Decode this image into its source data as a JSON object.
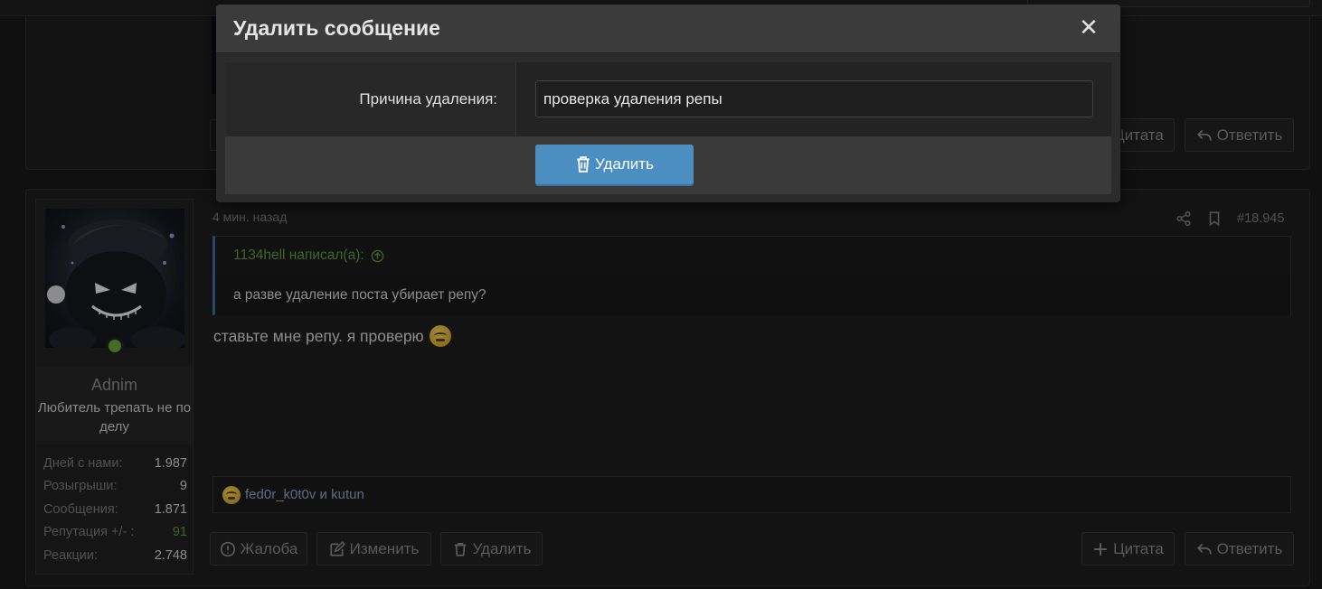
{
  "prev_post": {
    "quote_button": "Цитата",
    "reply_button": "Ответить"
  },
  "user": {
    "name": "Adnim",
    "title": "Любитель трепать не по делу",
    "stats": [
      {
        "label": "Дней с нами:",
        "value": "1.987"
      },
      {
        "label": "Розыгрыши:",
        "value": "9"
      },
      {
        "label": "Сообщения:",
        "value": "1.871"
      },
      {
        "label": "Репутация +/- :",
        "value": "91"
      },
      {
        "label": "Реакции:",
        "value": "2.748"
      }
    ]
  },
  "post": {
    "time": "4 мин. назад",
    "number": "#18.945",
    "quote_author": "1134hell написал(а):",
    "quote_text": "а разве удаление поста убирает репу?",
    "text": "ставьте мне репу. я проверю",
    "reactions_text": "fed0r_k0t0v и kutun",
    "actions": {
      "report": "Жалоба",
      "edit": "Изменить",
      "delete": "Удалить",
      "quote": "Цитата",
      "reply": "Ответить"
    }
  },
  "modal": {
    "title": "Удалить сообщение",
    "close": "✕",
    "reason_label": "Причина удаления:",
    "reason_value": "проверка удаления репы",
    "submit": "Удалить"
  },
  "icons": {
    "close": "close-icon",
    "trash": "trash-icon",
    "share": "share-icon",
    "bookmark": "bookmark-icon",
    "arrow-up": "arrow-up-circle-icon",
    "report": "exclamation-circle-icon",
    "edit": "edit-icon",
    "plus": "plus-icon",
    "reply": "reply-icon"
  },
  "colors": {
    "accent": "#4a8ec2",
    "reputation_green": "#5f9e3b",
    "quote_author": "#5d9c3a"
  }
}
